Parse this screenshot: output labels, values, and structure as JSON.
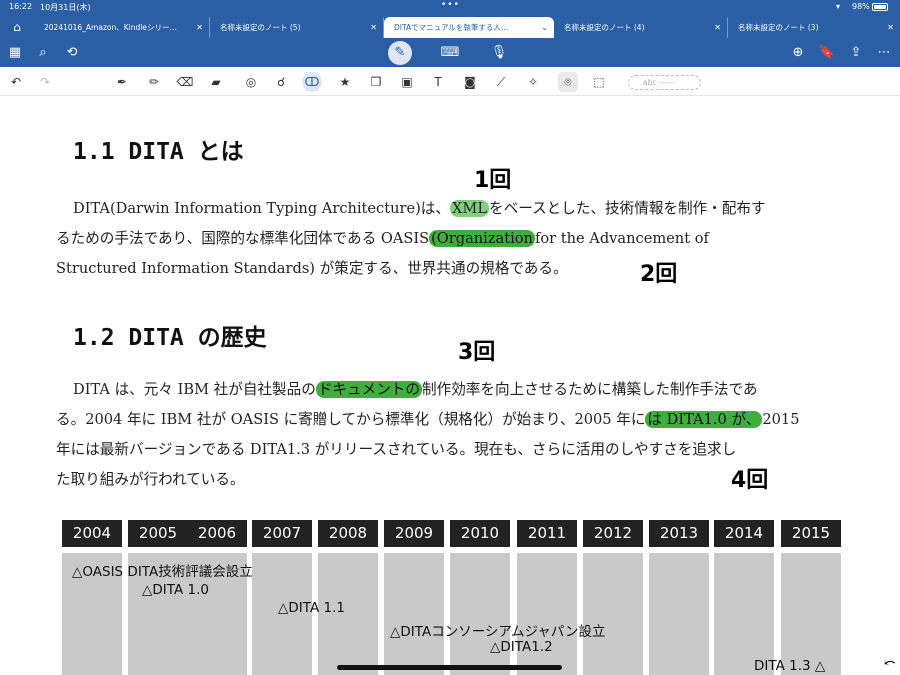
{
  "status": {
    "time": "16:22",
    "date": "10月31日(木)",
    "dots": "•••",
    "wifi": "▾",
    "battery": "98%"
  },
  "tabs": [
    {
      "label": "20241016_Amazon、Kindleシリー…"
    },
    {
      "label": "名称未設定のノート (5)"
    },
    {
      "label": "DITAでマニュアルを執筆する人…"
    },
    {
      "label": "名称未設定のノート (4)"
    },
    {
      "label": "名称未設定のノート (3)"
    }
  ],
  "toolbar2": {
    "abc_placeholder": "abc ------"
  },
  "section1": {
    "title": "1.1 DITA とは",
    "lines": [
      [
        "DITA(Darwin Information Typing Architecture)は、",
        "XML",
        "をベースとした、技術情報を制作・配布す"
      ],
      [
        "るための手法であり、国際的な標準化団体である OASIS",
        "(Organization",
        "for the Advancement of"
      ],
      [
        "Structured Information Standards) が策定する、世界共通の規格である。"
      ]
    ]
  },
  "section2": {
    "title": "1.2 DITA の歴史",
    "lines": [
      [
        "DITA は、元々 IBM 社が自社製品の",
        "ドキュメントの",
        "制作効率を向上させるために構築した制作手法であ"
      ],
      [
        "る。2004 年に IBM 社が OASIS に寄贈してから標準化（規格化）が始まり、2005 年に",
        "は DITA1.0 が、",
        "2015"
      ],
      [
        "年には最新バージョンである DITA1.3 がリリースされている。現在も、さらに活用のしやすさを追求し"
      ],
      [
        "た取り組みが行われている。"
      ]
    ]
  },
  "annotations": [
    "1回",
    "2回",
    "3回",
    "4回"
  ],
  "timeline": {
    "years": [
      "2004",
      "2005",
      "2006",
      "2007",
      "2008",
      "2009",
      "2010",
      "2011",
      "2012",
      "2013",
      "2014",
      "2015"
    ],
    "events": [
      "△OASIS DITA技術評議会設立",
      "△DITA 1.0",
      "△DITA 1.1",
      "△DITAコンソーシアムジャパン設立",
      "△DITA1.2",
      "DITA 1.3 △"
    ]
  }
}
